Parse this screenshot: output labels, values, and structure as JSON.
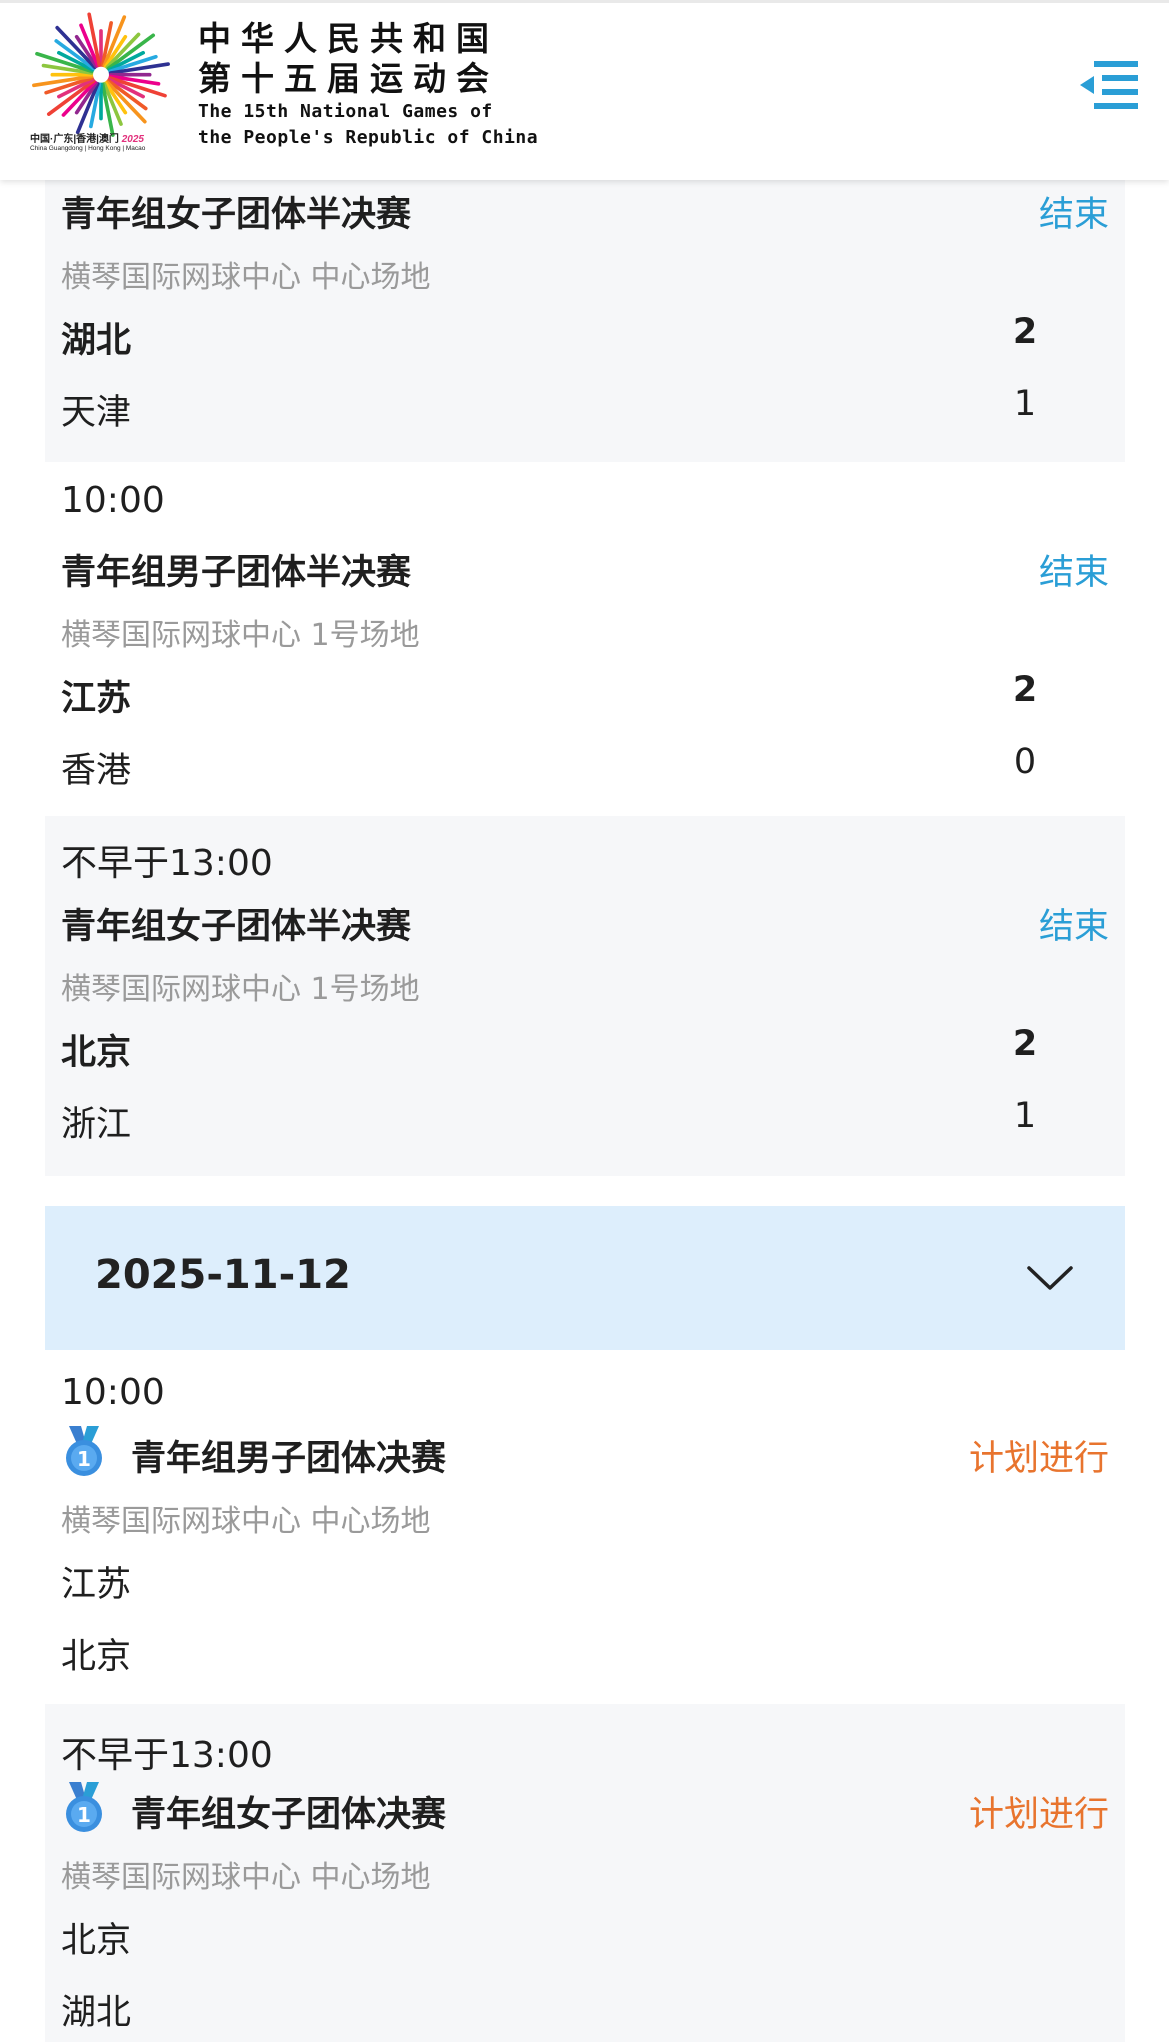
{
  "header": {
    "title_line1": "中华人民共和国",
    "title_line2": "第十五届运动会",
    "title_en_line1": "The 15th National Games of",
    "title_en_line2": "the People's Republic of China",
    "logo_caption_cn": "中国·广东|香港|澳门",
    "logo_caption_year": "2025",
    "logo_caption_en": "China Guangdong | Hong Kong | Macao",
    "menu_icon": "menu-lines-icon"
  },
  "matches_day1": [
    {
      "time": "",
      "title": "青年组女子团体半决赛",
      "status": "结束",
      "venue": "横琴国际网球中心 中心场地",
      "team1": "湖北",
      "score1": "2",
      "team2": "天津",
      "score2": "1"
    },
    {
      "time": "10:00",
      "title": "青年组男子团体半决赛",
      "status": "结束",
      "venue": "横琴国际网球中心 1号场地",
      "team1": "江苏",
      "score1": "2",
      "team2": "香港",
      "score2": "0"
    },
    {
      "time": "不早于13:00",
      "title": "青年组女子团体半决赛",
      "status": "结束",
      "venue": "横琴国际网球中心 1号场地",
      "team1": "北京",
      "score1": "2",
      "team2": "浙江",
      "score2": "1"
    }
  ],
  "date_section": {
    "date": "2025-11-12",
    "toggle_icon": "chevron-down-icon"
  },
  "matches_day2": [
    {
      "time": "10:00",
      "medal_icon": "gold-medal-icon",
      "title": "青年组男子团体决赛",
      "status": "计划进行",
      "venue": "横琴国际网球中心 中心场地",
      "team1": "江苏",
      "team2": "北京"
    },
    {
      "time": "不早于13:00",
      "medal_icon": "gold-medal-icon",
      "title": "青年组女子团体决赛",
      "status": "计划进行",
      "venue": "横琴国际网球中心 中心场地",
      "team1": "北京",
      "team2": "湖北"
    }
  ],
  "colors": {
    "status_done": "#2a9ed6",
    "status_planned": "#e8742e",
    "date_bar_bg": "#ddeefc",
    "card_grey_bg": "#f6f7f9",
    "menu_icon": "#2a9ed6"
  }
}
